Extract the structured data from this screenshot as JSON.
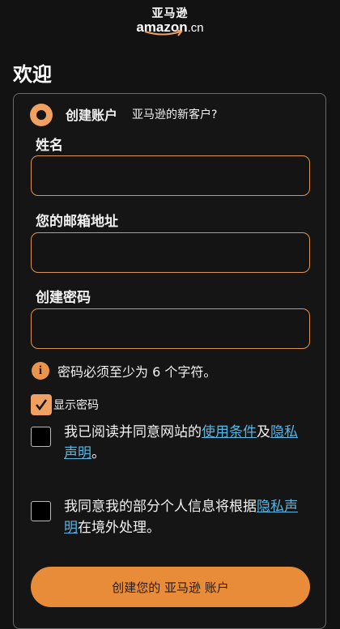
{
  "logo": {
    "line1": "亚马逊",
    "line2_main": "amazon",
    "line2_suffix": ".cn"
  },
  "page": {
    "title": "欢迎"
  },
  "create_option": {
    "label": "创建账户",
    "sub": "亚马逊的新客户?"
  },
  "form": {
    "name_label": "姓名",
    "name_value": "",
    "email_label": "您的邮箱地址",
    "email_value": "",
    "password_label": "创建密码",
    "password_value": "",
    "password_hint": "密码必须至少为 6 个字符。",
    "show_password_label": "显示密码",
    "show_password_checked": true
  },
  "agreement1": {
    "prefix": "我已阅读并同意网站的",
    "link1": "使用条件",
    "middle": "及",
    "link2": "隐私声明",
    "suffix": "。",
    "checked": false
  },
  "agreement2": {
    "prefix": "我同意我的部分个人信息将根据",
    "link": "隐私声明",
    "suffix": "在境外处理。",
    "checked": false
  },
  "submit": {
    "label": "创建您的 亚马逊 账户"
  },
  "colors": {
    "accent": "#e98c3a",
    "link": "#57b6e4",
    "background": "#121212"
  }
}
